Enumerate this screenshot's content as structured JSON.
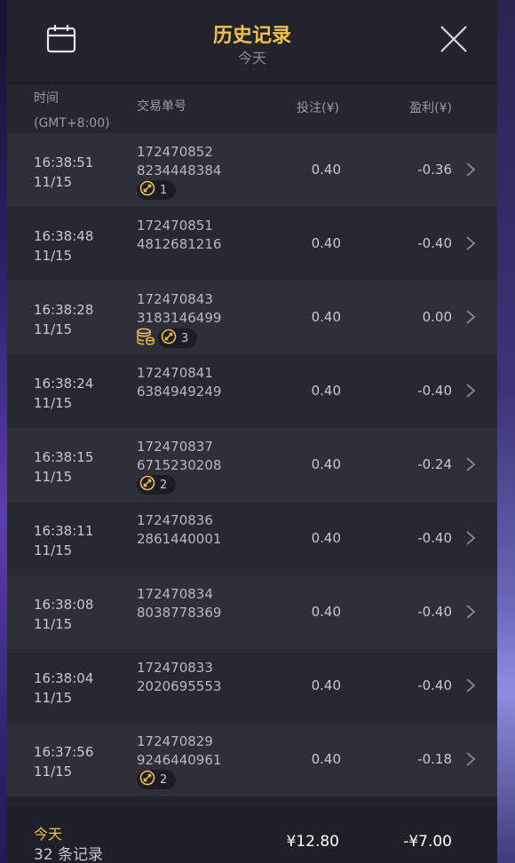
{
  "header": {
    "title": "历史记录",
    "subtitle": "今天",
    "calendar_icon": "calendar-icon",
    "close_icon": "close-icon"
  },
  "columns": {
    "time_label": "时间",
    "timezone": "(GMT+8:00)",
    "id_label": "交易单号",
    "bet_label": "投注(¥)",
    "pl_label": "盈利(¥)"
  },
  "rows": [
    {
      "time": "16:38:51",
      "date": "11/15",
      "id1": "172470852",
      "id2": "8234448384",
      "bet": "0.40",
      "pl": "-0.36",
      "coins": false,
      "spins": "1"
    },
    {
      "time": "16:38:48",
      "date": "11/15",
      "id1": "172470851",
      "id2": "4812681216",
      "bet": "0.40",
      "pl": "-0.40",
      "coins": false,
      "spins": null
    },
    {
      "time": "16:38:28",
      "date": "11/15",
      "id1": "172470843",
      "id2": "3183146499",
      "bet": "0.40",
      "pl": "0.00",
      "coins": true,
      "spins": "3"
    },
    {
      "time": "16:38:24",
      "date": "11/15",
      "id1": "172470841",
      "id2": "6384949249",
      "bet": "0.40",
      "pl": "-0.40",
      "coins": false,
      "spins": null
    },
    {
      "time": "16:38:15",
      "date": "11/15",
      "id1": "172470837",
      "id2": "6715230208",
      "bet": "0.40",
      "pl": "-0.24",
      "coins": false,
      "spins": "2"
    },
    {
      "time": "16:38:11",
      "date": "11/15",
      "id1": "172470836",
      "id2": "2861440001",
      "bet": "0.40",
      "pl": "-0.40",
      "coins": false,
      "spins": null
    },
    {
      "time": "16:38:08",
      "date": "11/15",
      "id1": "172470834",
      "id2": "8038778369",
      "bet": "0.40",
      "pl": "-0.40",
      "coins": false,
      "spins": null
    },
    {
      "time": "16:38:04",
      "date": "11/15",
      "id1": "172470833",
      "id2": "2020695553",
      "bet": "0.40",
      "pl": "-0.40",
      "coins": false,
      "spins": null
    },
    {
      "time": "16:37:56",
      "date": "11/15",
      "id1": "172470829",
      "id2": "9246440961",
      "bet": "0.40",
      "pl": "-0.18",
      "coins": false,
      "spins": "2"
    }
  ],
  "footer": {
    "label": "今天",
    "count": "32 条记录",
    "total_bet": "¥12.80",
    "total_pl": "-¥7.00"
  },
  "colors": {
    "accent": "#f2c14a",
    "panel": "#23232c"
  }
}
